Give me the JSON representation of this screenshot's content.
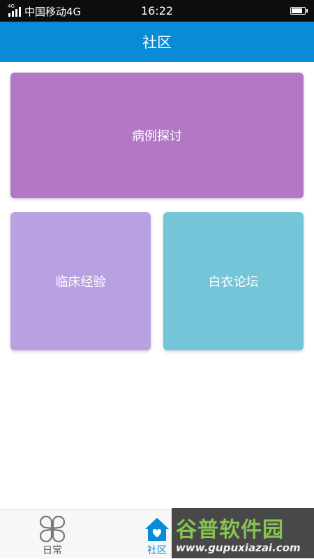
{
  "status_bar": {
    "network_badge": "4G",
    "carrier": "中国移动4G",
    "time": "16:22",
    "battery_level": 0.9
  },
  "header": {
    "title": "社区"
  },
  "cards": [
    {
      "label": "病例探讨",
      "color": "#b277c5"
    },
    {
      "label": "临床经验",
      "color": "#b9a1e1"
    },
    {
      "label": "白衣论坛",
      "color": "#74c5d8"
    }
  ],
  "bottom_nav": {
    "items": [
      {
        "label": "日常",
        "icon": "clover-icon",
        "active": false
      },
      {
        "label": "社区",
        "icon": "home-heart-icon",
        "active": true
      }
    ],
    "active_color": "#0a8bd6"
  },
  "watermark": {
    "brand": "谷普软件园",
    "url": "www.gupuxiazai.com"
  }
}
